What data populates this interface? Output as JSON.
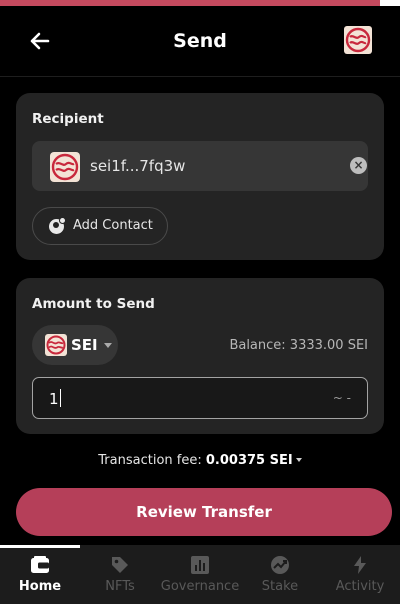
{
  "header": {
    "title": "Send",
    "back_icon": "arrow-left-icon",
    "logo": "sei-logo"
  },
  "recipient": {
    "label": "Recipient",
    "address": "sei1f...7fq3w",
    "clear_icon": "clear-icon",
    "add_contact_label": "Add Contact"
  },
  "amount": {
    "label": "Amount to Send",
    "token_symbol": "SEI",
    "balance_text": "Balance: 3333.00 SEI",
    "value": "1",
    "fiat_value": "~ -"
  },
  "fee": {
    "label": "Transaction fee:",
    "value": "0.00375 SEI"
  },
  "review_button": "Review Transfer",
  "nav": {
    "active": "Home",
    "items": [
      {
        "label": "Home",
        "icon": "wallet-icon"
      },
      {
        "label": "NFTs",
        "icon": "tag-icon"
      },
      {
        "label": "Governance",
        "icon": "chart-icon"
      },
      {
        "label": "Stake",
        "icon": "stake-icon"
      },
      {
        "label": "Activity",
        "icon": "bolt-icon"
      }
    ]
  },
  "colors": {
    "accent": "#b53f59",
    "background": "#000000",
    "card": "#242424",
    "logo_red": "#c8283c",
    "logo_bg": "#f3e3d6"
  }
}
